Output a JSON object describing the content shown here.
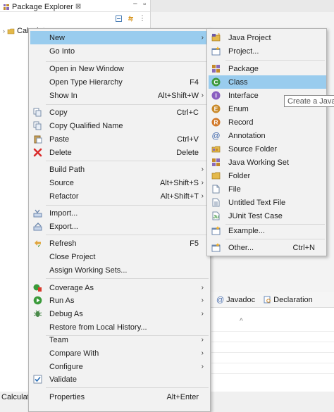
{
  "explorer": {
    "tab_label": "Package Explorer",
    "project_label": "Calculator"
  },
  "bottom_panel": {
    "tabs": [
      {
        "label": "Javadoc",
        "icon": "at-icon"
      },
      {
        "label": "Declaration",
        "icon": "declaration-icon"
      }
    ],
    "sort_glyph": "^"
  },
  "status_bar": {
    "text": "Calculator"
  },
  "context_menu": {
    "items": [
      {
        "label": "New",
        "shortcut": "",
        "submenu": true,
        "highlighted": true
      },
      {
        "label": "Go Into",
        "shortcut": ""
      },
      {
        "label": "Open in New Window",
        "shortcut": ""
      },
      {
        "label": "Open Type Hierarchy",
        "shortcut": "F4"
      },
      {
        "label": "Show In",
        "shortcut": "Alt+Shift+W",
        "submenu": true
      },
      {
        "label": "Copy",
        "shortcut": "Ctrl+C",
        "icon": "copy-icon"
      },
      {
        "label": "Copy Qualified Name",
        "shortcut": "",
        "icon": "copy-qualified-icon"
      },
      {
        "label": "Paste",
        "shortcut": "Ctrl+V",
        "icon": "paste-icon"
      },
      {
        "label": "Delete",
        "shortcut": "Delete",
        "icon": "delete-icon"
      },
      {
        "label": "Build Path",
        "shortcut": "",
        "submenu": true
      },
      {
        "label": "Source",
        "shortcut": "Alt+Shift+S",
        "submenu": true
      },
      {
        "label": "Refactor",
        "shortcut": "Alt+Shift+T",
        "submenu": true
      },
      {
        "label": "Import...",
        "shortcut": "",
        "icon": "import-icon"
      },
      {
        "label": "Export...",
        "shortcut": "",
        "icon": "export-icon"
      },
      {
        "label": "Refresh",
        "shortcut": "F5",
        "icon": "refresh-icon"
      },
      {
        "label": "Close Project",
        "shortcut": ""
      },
      {
        "label": "Assign Working Sets...",
        "shortcut": ""
      },
      {
        "label": "Coverage As",
        "shortcut": "",
        "submenu": true,
        "icon": "coverage-icon"
      },
      {
        "label": "Run As",
        "shortcut": "",
        "submenu": true,
        "icon": "run-icon"
      },
      {
        "label": "Debug As",
        "shortcut": "",
        "submenu": true,
        "icon": "debug-icon"
      },
      {
        "label": "Restore from Local History...",
        "shortcut": ""
      },
      {
        "label": "Team",
        "shortcut": "",
        "submenu": true
      },
      {
        "label": "Compare With",
        "shortcut": "",
        "submenu": true
      },
      {
        "label": "Configure",
        "shortcut": "",
        "submenu": true
      },
      {
        "label": "Validate",
        "shortcut": "",
        "icon": "check-icon"
      },
      {
        "label": "Properties",
        "shortcut": "Alt+Enter"
      }
    ]
  },
  "new_submenu": {
    "items": [
      {
        "label": "Java Project",
        "icon": "java-project-icon"
      },
      {
        "label": "Project...",
        "icon": "project-icon"
      },
      {
        "label": "Package",
        "icon": "package-icon"
      },
      {
        "label": "Class",
        "icon": "class-icon",
        "highlighted": true
      },
      {
        "label": "Interface",
        "icon": "interface-icon"
      },
      {
        "label": "Enum",
        "icon": "enum-icon"
      },
      {
        "label": "Record",
        "icon": "record-icon"
      },
      {
        "label": "Annotation",
        "icon": "annotation-icon"
      },
      {
        "label": "Source Folder",
        "icon": "source-folder-icon"
      },
      {
        "label": "Java Working Set",
        "icon": "working-set-icon"
      },
      {
        "label": "Folder",
        "icon": "folder-icon"
      },
      {
        "label": "File",
        "icon": "file-icon"
      },
      {
        "label": "Untitled Text File",
        "icon": "text-file-icon"
      },
      {
        "label": "JUnit Test Case",
        "icon": "junit-icon"
      },
      {
        "label": "Example...",
        "icon": "example-icon"
      },
      {
        "label": "Other...",
        "icon": "other-icon",
        "shortcut": "Ctrl+N"
      }
    ]
  },
  "tooltip": {
    "text": "Create a Java c"
  },
  "colors": {
    "highlight": "#99ccee",
    "menu_bg": "#f2f2f2",
    "separator": "#d8d8d8"
  }
}
